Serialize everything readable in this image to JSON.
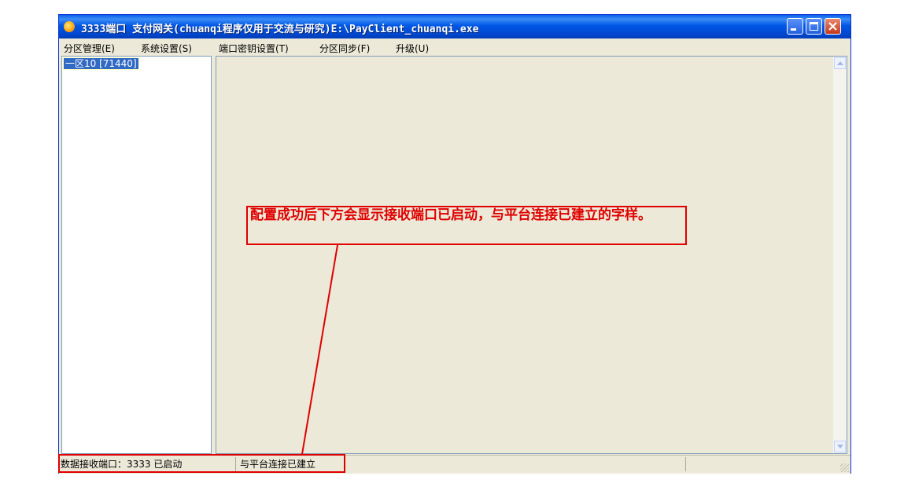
{
  "window": {
    "title": "3333端口 支付网关(chuanqi程序仅用于交流与研究)E:\\PayClient_chuanqi.exe"
  },
  "menu": [
    {
      "label": "分区管理(E)"
    },
    {
      "label": "系统设置(S)"
    },
    {
      "label": "端口密钥设置(T)"
    },
    {
      "label": "分区同步(F)"
    },
    {
      "label": "升级(U)"
    }
  ],
  "tree": {
    "selected_item": "一区10 [71440]"
  },
  "annotation": {
    "text": "配置成功后下方会显示接收端口已启动，与平台连接已建立的字样。",
    "color": "#e00000"
  },
  "status": {
    "port_text": "数据接收端口：3333  已启动",
    "connection_text": "与平台连接已建立"
  },
  "icons": {
    "app": "app-icon",
    "minimize": "minimize-icon",
    "maximize": "maximize-icon",
    "close": "close-icon"
  }
}
